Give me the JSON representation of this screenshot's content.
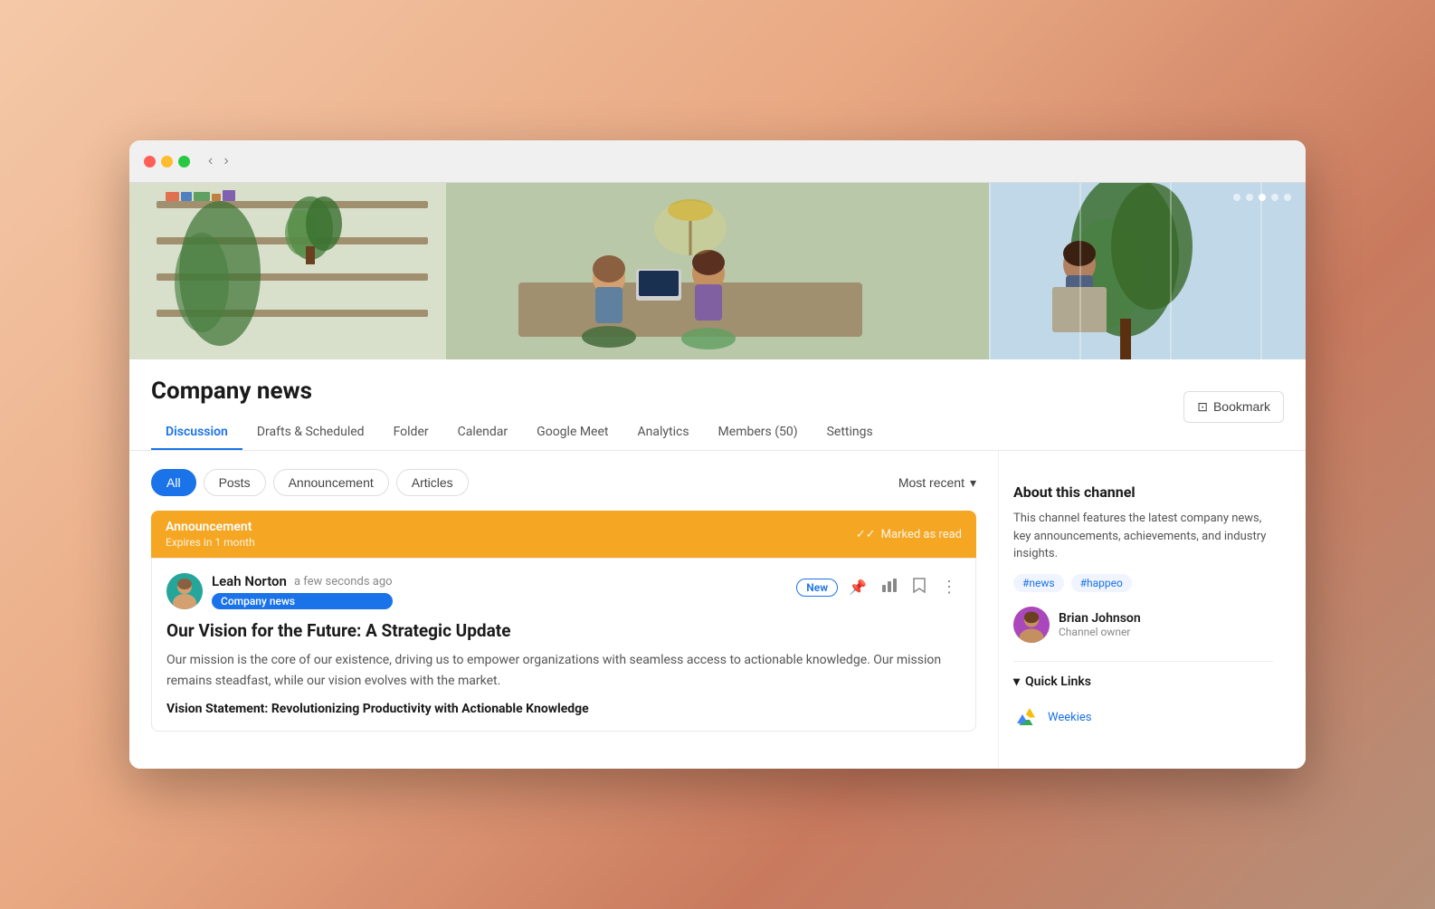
{
  "browser": {
    "back_label": "‹",
    "forward_label": "›"
  },
  "hero": {
    "carousel_dots": [
      false,
      false,
      true,
      false,
      false
    ]
  },
  "channel": {
    "title": "Company news",
    "bookmark_label": "Bookmark",
    "tabs": [
      {
        "label": "Discussion",
        "active": true
      },
      {
        "label": "Drafts & Scheduled",
        "active": false
      },
      {
        "label": "Folder",
        "active": false
      },
      {
        "label": "Calendar",
        "active": false
      },
      {
        "label": "Google Meet",
        "active": false
      },
      {
        "label": "Analytics",
        "active": false
      },
      {
        "label": "Members (50)",
        "active": false
      },
      {
        "label": "Settings",
        "active": false
      }
    ]
  },
  "feed": {
    "filter_pills": [
      {
        "label": "All",
        "active": true
      },
      {
        "label": "Posts",
        "active": false
      },
      {
        "label": "Announcement",
        "active": false
      },
      {
        "label": "Articles",
        "active": false
      }
    ],
    "sort_label": "Most recent",
    "announcement": {
      "label": "Announcement",
      "expires": "Expires in 1 month",
      "marked_read_label": "Marked as read"
    },
    "post": {
      "author_name": "Leah Norton",
      "post_time": "a few seconds ago",
      "tag": "Company news",
      "new_badge": "New",
      "title": "Our Vision for the Future: A Strategic Update",
      "excerpt": "Our mission is the core of our existence, driving us to empower organizations with seamless access to actionable knowledge. Our mission remains steadfast, while our vision evolves with the market.",
      "vision_statement": "Vision Statement: Revolutionizing Productivity with Actionable Knowledge"
    }
  },
  "sidebar": {
    "about_title": "About this channel",
    "about_text": "This channel features the latest company news, key announcements, achievements, and industry insights.",
    "tags": [
      "#news",
      "#happeo"
    ],
    "owner": {
      "name": "Brian Johnson",
      "role": "Channel owner"
    },
    "quick_links_label": "Quick Links",
    "quick_links": [
      {
        "name": "Weekies",
        "icon": "google-drive"
      }
    ]
  },
  "icons": {
    "bookmark": "⊡",
    "pin": "📌",
    "analytics": "📊",
    "bookmark_post": "🔖",
    "more": "⋮",
    "checkmark": "✓✓",
    "chevron_down": "▼"
  }
}
